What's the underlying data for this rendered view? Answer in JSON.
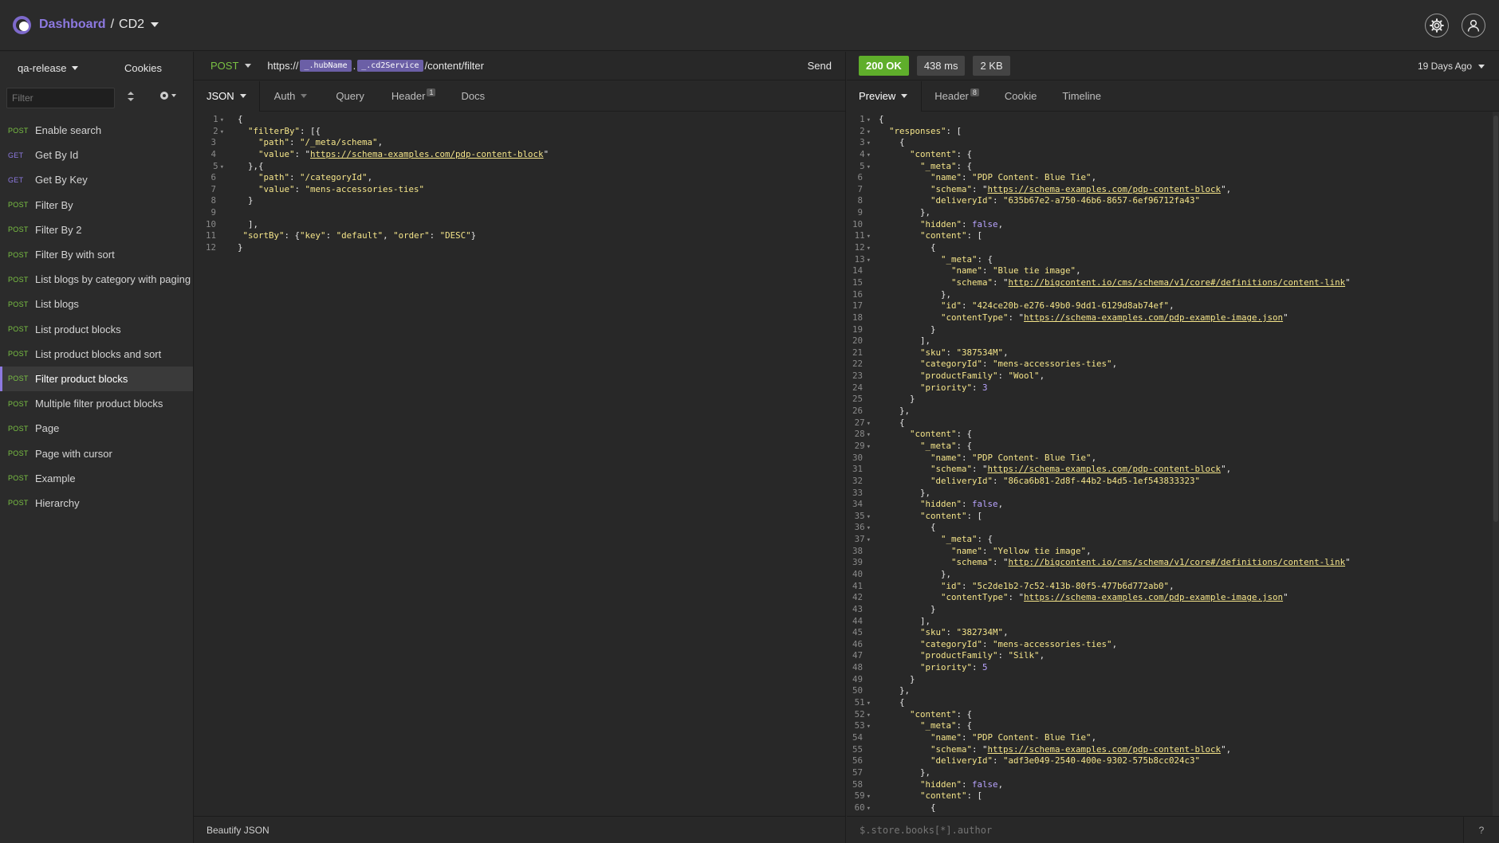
{
  "header": {
    "dashboard": "Dashboard",
    "separator": "/",
    "workspace": "CD2"
  },
  "sidebar": {
    "environment": "qa-release",
    "cookies": "Cookies",
    "filter_placeholder": "Filter",
    "items": [
      {
        "method": "POST",
        "name": "Enable search"
      },
      {
        "method": "GET",
        "name": "Get By Id"
      },
      {
        "method": "GET",
        "name": "Get By Key"
      },
      {
        "method": "POST",
        "name": "Filter By"
      },
      {
        "method": "POST",
        "name": "Filter By 2"
      },
      {
        "method": "POST",
        "name": "Filter By with sort"
      },
      {
        "method": "POST",
        "name": "List blogs by category with paging"
      },
      {
        "method": "POST",
        "name": "List blogs"
      },
      {
        "method": "POST",
        "name": "List product blocks"
      },
      {
        "method": "POST",
        "name": "List product blocks and sort"
      },
      {
        "method": "POST",
        "name": "Filter product blocks",
        "active": true
      },
      {
        "method": "POST",
        "name": "Multiple filter product blocks"
      },
      {
        "method": "POST",
        "name": "Page"
      },
      {
        "method": "POST",
        "name": "Page with cursor"
      },
      {
        "method": "POST",
        "name": "Example"
      },
      {
        "method": "POST",
        "name": "Hierarchy"
      }
    ]
  },
  "request": {
    "method": "POST",
    "url_prefix": "https://",
    "url_var1": "_.hubName",
    "url_dot": ".",
    "url_var2": "_.cd2Service",
    "url_suffix": "/content/filter",
    "send": "Send",
    "tabs": [
      {
        "label": "JSON"
      },
      {
        "label": "Auth"
      },
      {
        "label": "Query"
      },
      {
        "label": "Header",
        "badge": "1"
      },
      {
        "label": "Docs"
      }
    ],
    "footer": "Beautify JSON",
    "body_lines": [
      "{",
      "  \"filterBy\": [{",
      "    \"path\": \"/_meta/schema\",",
      "    \"value\": \"https://schema-examples.com/pdp-content-block\"",
      "  },{",
      "    \"path\": \"/categoryId\",",
      "    \"value\": \"mens-accessories-ties\"",
      "  }",
      "",
      "  ],",
      " \"sortBy\": {\"key\": \"default\", \"order\": \"DESC\"}",
      "}"
    ]
  },
  "response": {
    "status": "200 OK",
    "time": "438 ms",
    "size": "2 KB",
    "ago": "19 Days Ago",
    "tabs": [
      {
        "label": "Preview"
      },
      {
        "label": "Header",
        "badge": "8"
      },
      {
        "label": "Cookie"
      },
      {
        "label": "Timeline"
      }
    ],
    "filter_placeholder": "$.store.books[*].author",
    "help": "?",
    "body_lines": [
      "{",
      "  \"responses\": [",
      "    {",
      "      \"content\": {",
      "        \"_meta\": {",
      "          \"name\": \"PDP Content- Blue Tie\",",
      "          \"schema\": \"https://schema-examples.com/pdp-content-block\",",
      "          \"deliveryId\": \"635b67e2-a750-46b6-8657-6ef96712fa43\"",
      "        },",
      "        \"hidden\": false,",
      "        \"content\": [",
      "          {",
      "            \"_meta\": {",
      "              \"name\": \"Blue tie image\",",
      "              \"schema\": \"http://bigcontent.io/cms/schema/v1/core#/definitions/content-link\"",
      "            },",
      "            \"id\": \"424ce20b-e276-49b0-9dd1-6129d8ab74ef\",",
      "            \"contentType\": \"https://schema-examples.com/pdp-example-image.json\"",
      "          }",
      "        ],",
      "        \"sku\": \"387534M\",",
      "        \"categoryId\": \"mens-accessories-ties\",",
      "        \"productFamily\": \"Wool\",",
      "        \"priority\": 3",
      "      }",
      "    },",
      "    {",
      "      \"content\": {",
      "        \"_meta\": {",
      "          \"name\": \"PDP Content- Blue Tie\",",
      "          \"schema\": \"https://schema-examples.com/pdp-content-block\",",
      "          \"deliveryId\": \"86ca6b81-2d8f-44b2-b4d5-1ef543833323\"",
      "        },",
      "        \"hidden\": false,",
      "        \"content\": [",
      "          {",
      "            \"_meta\": {",
      "              \"name\": \"Yellow tie image\",",
      "              \"schema\": \"http://bigcontent.io/cms/schema/v1/core#/definitions/content-link\"",
      "            },",
      "            \"id\": \"5c2de1b2-7c52-413b-80f5-477b6d772ab0\",",
      "            \"contentType\": \"https://schema-examples.com/pdp-example-image.json\"",
      "          }",
      "        ],",
      "        \"sku\": \"382734M\",",
      "        \"categoryId\": \"mens-accessories-ties\",",
      "        \"productFamily\": \"Silk\",",
      "        \"priority\": 5",
      "      }",
      "    },",
      "    {",
      "      \"content\": {",
      "        \"_meta\": {",
      "          \"name\": \"PDP Content- Blue Tie\",",
      "          \"schema\": \"https://schema-examples.com/pdp-content-block\",",
      "          \"deliveryId\": \"adf3e049-2540-400e-9302-575b8cc024c3\"",
      "        },",
      "        \"hidden\": false,",
      "        \"content\": [",
      "          {"
    ]
  },
  "colors": {
    "accent": "#8d79e0",
    "post": "#7ac143",
    "status_ok": "#5fae2b",
    "string": "#f5e58a"
  }
}
